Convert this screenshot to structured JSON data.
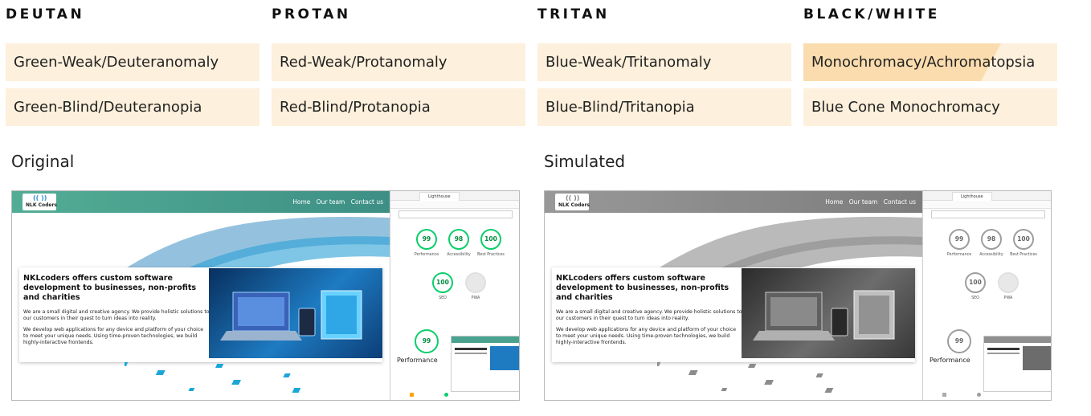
{
  "groups": [
    {
      "title": "DEUTAN",
      "options": [
        "Green-Weak/Deuteranomaly",
        "Green-Blind/Deuteranopia"
      ]
    },
    {
      "title": "PROTAN",
      "options": [
        "Red-Weak/Protanomaly",
        "Red-Blind/Protanopia"
      ]
    },
    {
      "title": "TRITAN",
      "options": [
        "Blue-Weak/Tritanomaly",
        "Blue-Blind/Tritanopia"
      ]
    },
    {
      "title": "BLACK/WHITE",
      "options": [
        "Monochromacy/Achromatopsia",
        "Blue Cone Monochromacy"
      ]
    }
  ],
  "selected_option": "Monochromacy/Achromatopsia",
  "labels": {
    "original": "Original",
    "simulated": "Simulated"
  },
  "website": {
    "logo_text": "NLK Coders",
    "nav": [
      "Home",
      "Our team",
      "Contact us"
    ],
    "headline": "NKLcoders offers custom software development to businesses, non-profits and charities",
    "para1": "We are a small digital and creative agency. We provide holistic solutions to our customers in their quest to turn ideas into reality.",
    "para2": "We develop web applications for any device and platform of your choice to meet your unique needs. Using time-proven technologies, we build highly-interactive frontends."
  },
  "devtools": {
    "tab": "Lighthouse",
    "scores": [
      {
        "value": "99",
        "label": "Performance"
      },
      {
        "value": "98",
        "label": "Accessibility"
      },
      {
        "value": "100",
        "label": "Best Practices"
      },
      {
        "value": "100",
        "label": "SEO"
      },
      {
        "value": "",
        "label": "PWA"
      }
    ],
    "big_score": "99",
    "big_label": "Performance"
  },
  "colors": {
    "option_bg": "#fdf0dc",
    "option_active": "#fbdcae",
    "nav_teal": "#4aa38f",
    "score_green": "#0cce6b",
    "text_dark": "#1c1c1c"
  }
}
